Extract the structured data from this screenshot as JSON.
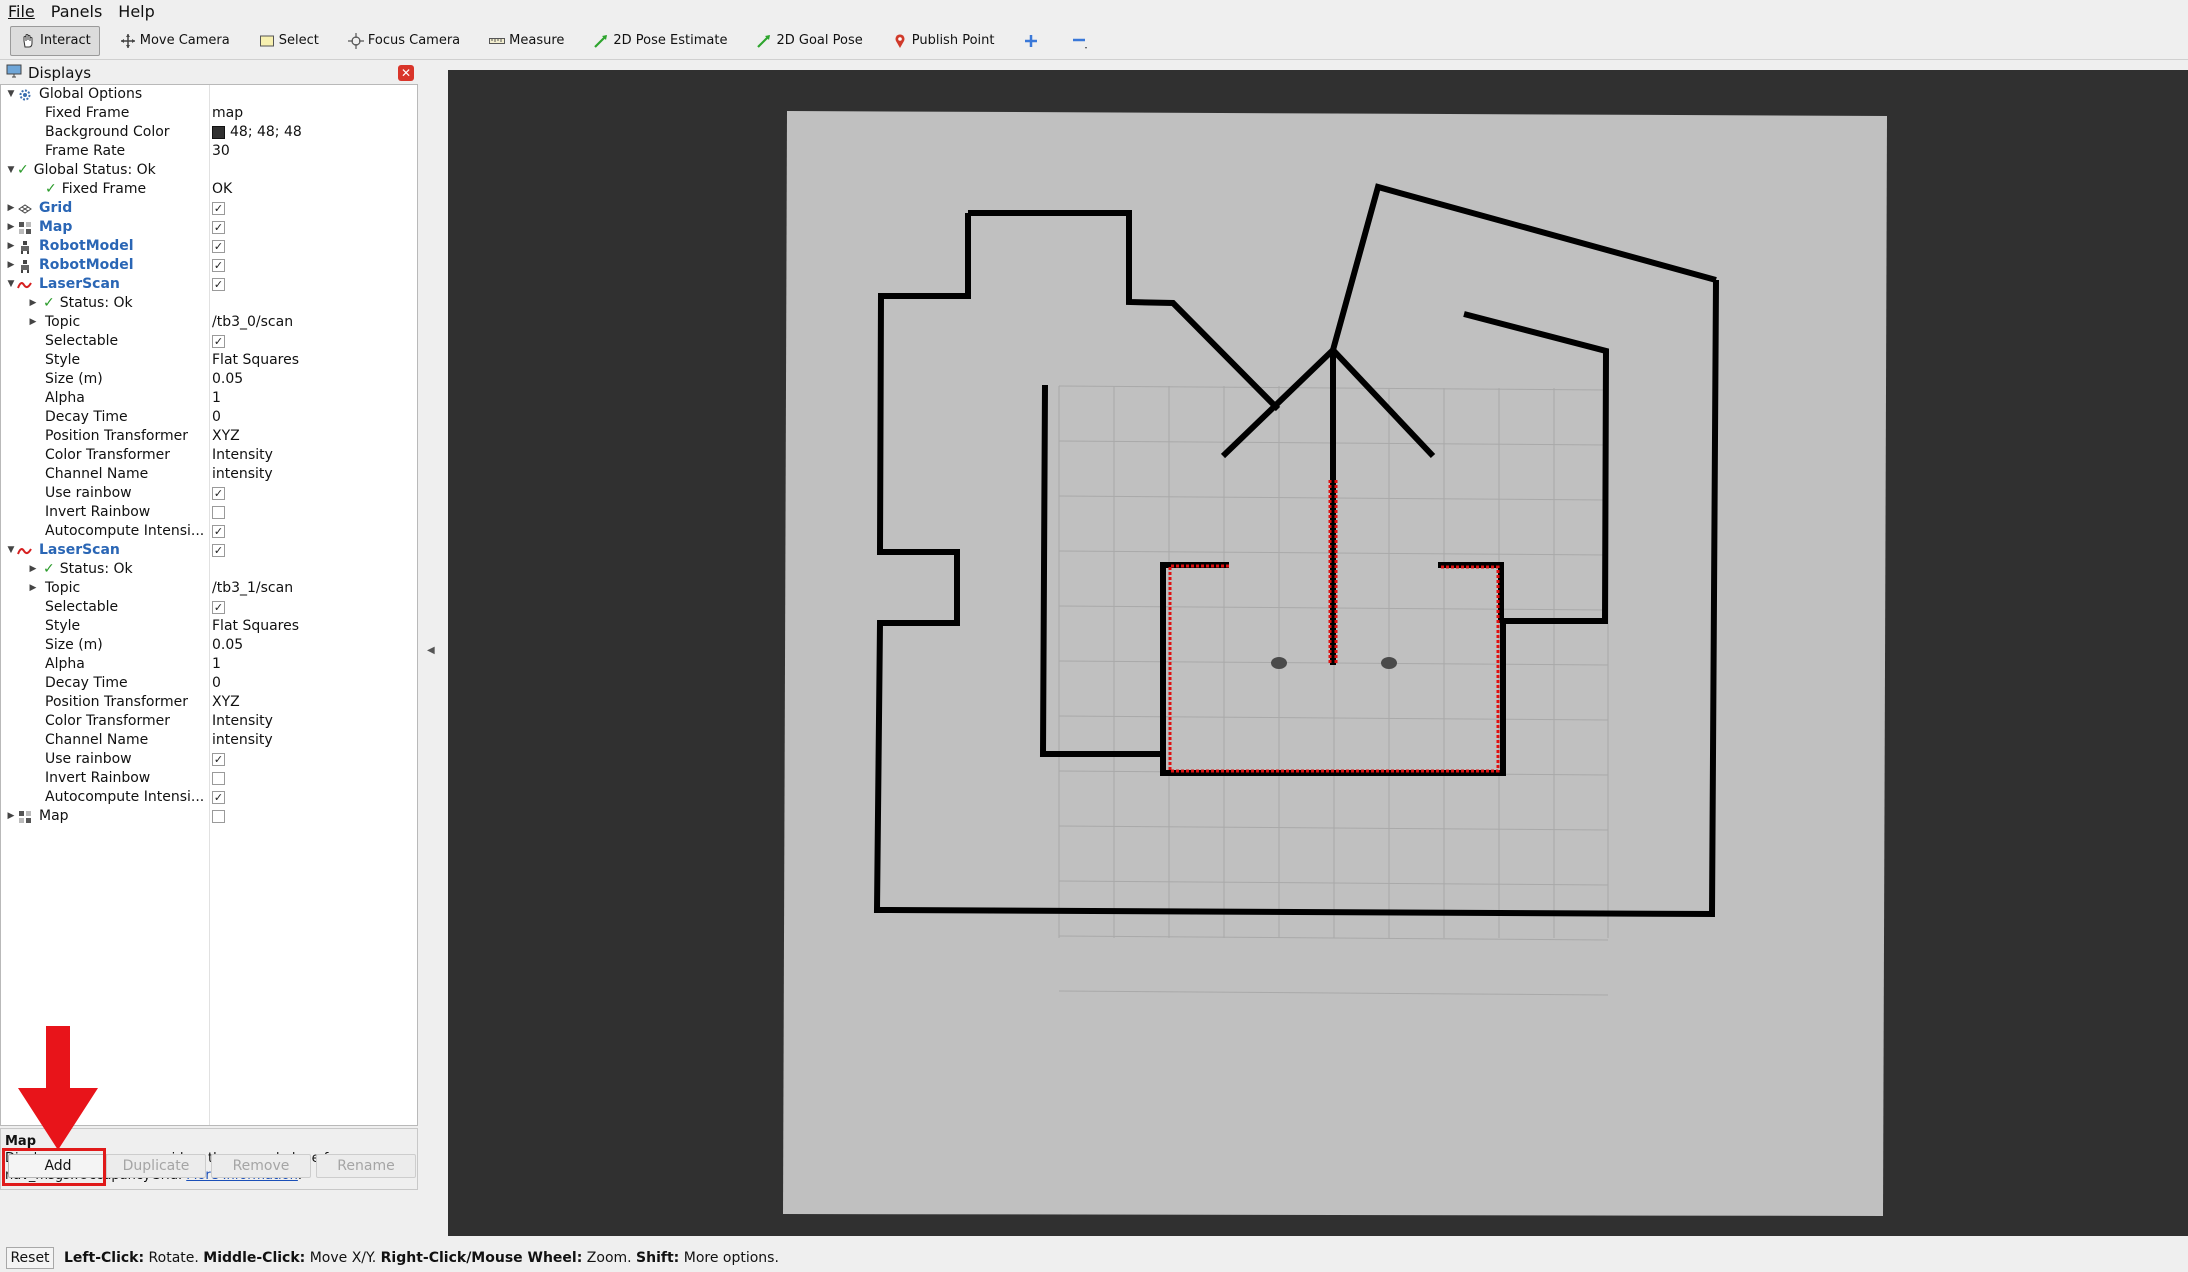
{
  "menu": [
    "File",
    "Panels",
    "Help"
  ],
  "toolbar": {
    "tools": [
      "Interact",
      "Move Camera",
      "Select",
      "Focus Camera",
      "Measure",
      "2D Pose Estimate",
      "2D Goal Pose",
      "Publish Point"
    ]
  },
  "displays": {
    "title": "Displays",
    "global_options": {
      "label": "Global Options",
      "fixed_frame_label": "Fixed Frame",
      "fixed_frame": "map",
      "background_color_label": "Background Color",
      "background_color": "48; 48; 48",
      "frame_rate_label": "Frame Rate",
      "frame_rate": "30"
    },
    "global_status": {
      "label": "Global Status: Ok",
      "fixed_frame_label": "Fixed Frame",
      "fixed_frame_value": "OK"
    },
    "items": {
      "grid": "Grid",
      "map": "Map",
      "robot1": "RobotModel",
      "robot2": "RobotModel"
    },
    "laser1": {
      "label": "LaserScan",
      "status": "Status: Ok",
      "topic_label": "Topic",
      "topic": "/tb3_0/scan",
      "selectable_label": "Selectable",
      "style_label": "Style",
      "style": "Flat Squares",
      "size_label": "Size (m)",
      "size": "0.05",
      "alpha_label": "Alpha",
      "alpha": "1",
      "decay_label": "Decay Time",
      "decay": "0",
      "pos_label": "Position Transformer",
      "pos": "XYZ",
      "color_label": "Color Transformer",
      "color": "Intensity",
      "channel_label": "Channel Name",
      "channel": "intensity",
      "rainbow_label": "Use rainbow",
      "invert_label": "Invert Rainbow",
      "autocompute_label": "Autocompute Intensi..."
    },
    "laser2": {
      "label": "LaserScan",
      "status": "Status: Ok",
      "topic_label": "Topic",
      "topic": "/tb3_1/scan",
      "selectable_label": "Selectable",
      "style_label": "Style",
      "style": "Flat Squares",
      "size_label": "Size (m)",
      "size": "0.05",
      "alpha_label": "Alpha",
      "alpha": "1",
      "decay_label": "Decay Time",
      "decay": "0",
      "pos_label": "Position Transformer",
      "pos": "XYZ",
      "color_label": "Color Transformer",
      "color": "Intensity",
      "channel_label": "Channel Name",
      "channel": "intensity",
      "rainbow_label": "Use rainbow",
      "invert_label": "Invert Rainbow",
      "autocompute_label": "Autocompute Intensi..."
    },
    "map2": "Map"
  },
  "description": {
    "title": "Map",
    "text": "Displays an occupancy grid on the ground plane from a nav_msgs::OccupancyGrid.",
    "link": "More Information"
  },
  "buttons": {
    "add": "Add",
    "duplicate": "Duplicate",
    "remove": "Remove",
    "rename": "Rename"
  },
  "status": {
    "reset": "Reset",
    "left_key": "Left-Click:",
    "left_val": "Rotate.",
    "mid_key": "Middle-Click:",
    "mid_val": "Move X/Y.",
    "right_key": "Right-Click/Mouse Wheel:",
    "right_val": "Zoom.",
    "shift_key": "Shift:",
    "shift_val": "More options."
  },
  "colors": {
    "view_background": "#303030",
    "map_free": "#c0c0c0",
    "wall": "#000000",
    "laser": "#e01010",
    "link": "#2a66b5"
  }
}
